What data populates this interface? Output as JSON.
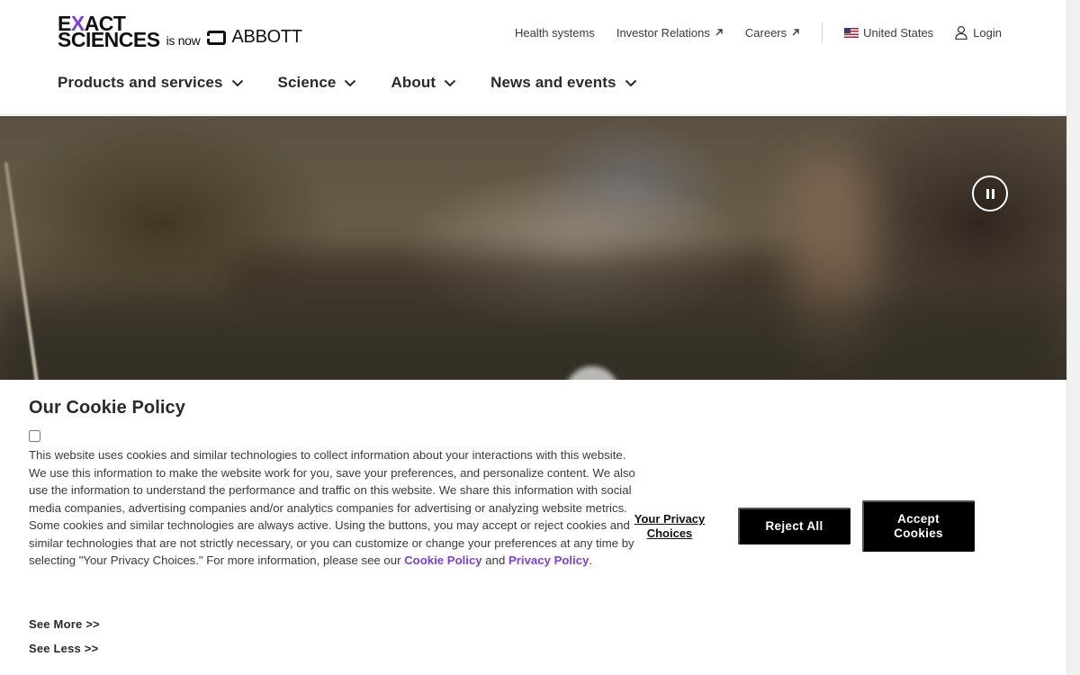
{
  "header": {
    "logo": {
      "line1_pre": "E",
      "line1_x": "X",
      "line1_post": "ACT",
      "line2": "SCIENCES",
      "is_now": "is now",
      "partner": "ABBOTT"
    },
    "utility_links": [
      {
        "label": "Health systems"
      },
      {
        "label": "Investor Relations"
      },
      {
        "label": "Careers"
      }
    ],
    "region": "United States",
    "login": "Login"
  },
  "main_nav": [
    {
      "label": "Products and services"
    },
    {
      "label": "Science"
    },
    {
      "label": "About"
    },
    {
      "label": "News and events"
    }
  ],
  "hero": {
    "icons": {
      "pause": "pause-icon"
    }
  },
  "cookie_banner": {
    "title": "Our Cookie Policy",
    "body_main": "This website uses cookies and similar technologies to collect information about your interactions with this website. We use this information to make the website work for you, save your preferences, and personalize content. We also use the information to understand the performance and traffic on this website. We share this information with social media companies, advertising companies and/or analytics companies for advertising or analyzing website metrics. Some cookies and similar technologies are always active. Using the buttons, you may accept or reject cookies and similar technologies that are not strictly necessary, or you can customize or change your preferences at any time by selecting \"Your Privacy Choices.\" For more information, please see our ",
    "cookie_policy_link": "Cookie Policy",
    "and": " and ",
    "privacy_policy_link": "Privacy Policy",
    "period": ".",
    "see_more": "See More >>",
    "see_less": "See Less >>",
    "privacy_choices": "Your Privacy Choices",
    "reject_all": "Reject All",
    "accept_cookies": "Accept Cookies"
  },
  "colors": {
    "accent": "#7b3fe4",
    "button_bg": "#000000",
    "text": "#2a2a2a"
  }
}
